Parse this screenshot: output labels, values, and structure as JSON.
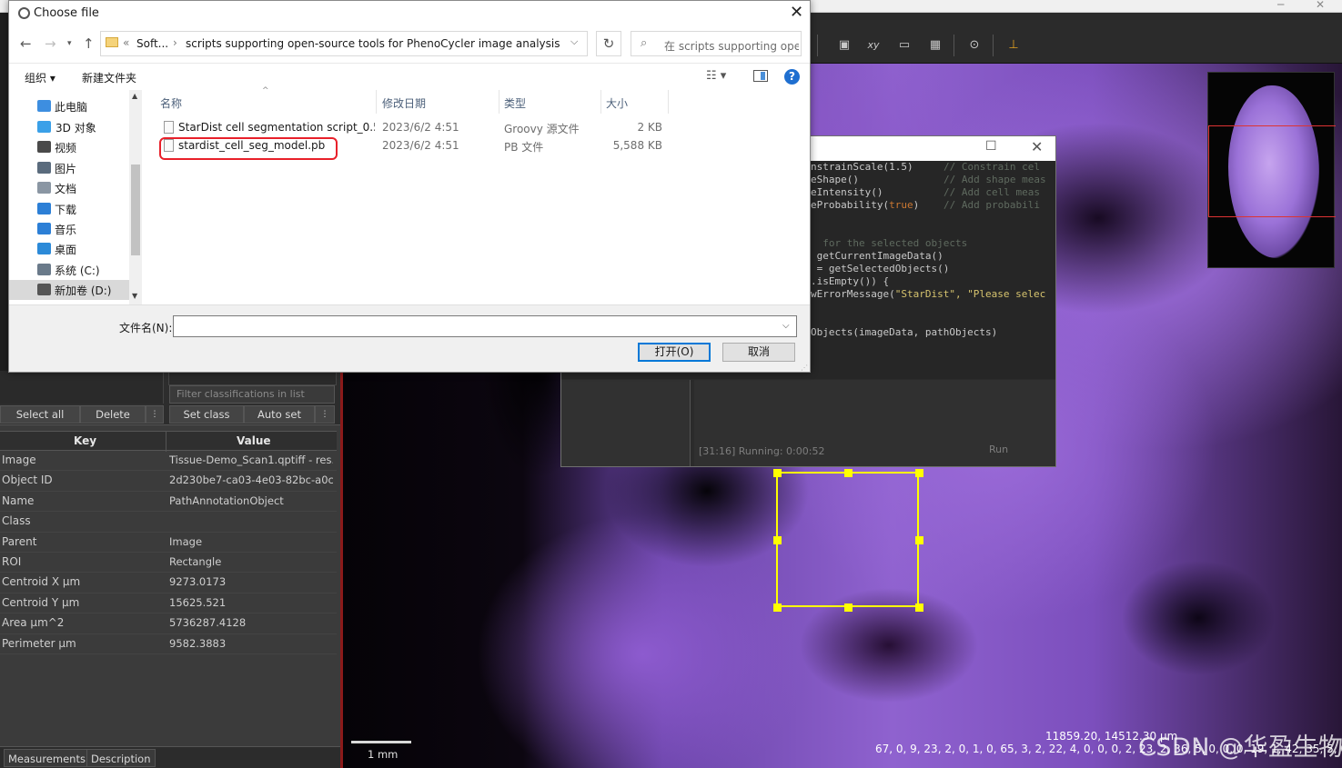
{
  "dialog": {
    "title": "Choose file",
    "address": {
      "overflow": "«",
      "crumbs": [
        "Soft...",
        "scripts supporting open-source tools for PhenoCycler image analysis"
      ]
    },
    "search_placeholder": "在 scripts supporting ope...",
    "commands": {
      "organize": "组织 ▾",
      "new_folder": "新建文件夹"
    },
    "nav_items": [
      {
        "label": "此电脑",
        "icon": "computer-icon",
        "color": "#3d8ee0"
      },
      {
        "label": "3D 对象",
        "icon": "cube-icon",
        "color": "#3aa0e8"
      },
      {
        "label": "视频",
        "icon": "film-icon",
        "color": "#4a4a4a"
      },
      {
        "label": "图片",
        "icon": "picture-icon",
        "color": "#5a6b7d"
      },
      {
        "label": "文档",
        "icon": "document-icon",
        "color": "#8a96a3"
      },
      {
        "label": "下载",
        "icon": "download-arrow-icon",
        "color": "#2c7fd6"
      },
      {
        "label": "音乐",
        "icon": "music-note-icon",
        "color": "#2c7fd6"
      },
      {
        "label": "桌面",
        "icon": "desktop-icon",
        "color": "#2c8ad8"
      },
      {
        "label": "系统 (C:)",
        "icon": "drive-c-icon",
        "color": "#6a7a8a"
      },
      {
        "label": "新加卷 (D:)",
        "icon": "drive-d-icon",
        "color": "#555555"
      }
    ],
    "columns": {
      "name": "名称",
      "modified": "修改日期",
      "type": "类型",
      "size": "大小"
    },
    "files": [
      {
        "name": "StarDist cell segmentation script_0.5_...",
        "modified": "2023/6/2 4:51",
        "type": "Groovy 源文件",
        "size": "2 KB"
      },
      {
        "name": "stardist_cell_seg_model.pb",
        "modified": "2023/6/2 4:51",
        "type": "PB 文件",
        "size": "5,588 KB"
      }
    ],
    "filename_label": "文件名(N):",
    "filename_value": "",
    "open_button": "打开(O)",
    "cancel_button": "取消",
    "highlight_color": "#e8202a"
  },
  "left_panel": {
    "filter_placeholder": "Filter classifications in list",
    "buttons": {
      "select_all": "Select all",
      "delete": "Delete",
      "set_class": "Set class",
      "auto_set": "Auto set"
    },
    "table_headers": {
      "key": "Key",
      "value": "Value"
    },
    "rows": [
      {
        "key": "Image",
        "value": "Tissue-Demo_Scan1.qptiff - res..."
      },
      {
        "key": "Object ID",
        "value": "2d230be7-ca03-4e03-82bc-a0c..."
      },
      {
        "key": "Name",
        "value": "PathAnnotationObject"
      },
      {
        "key": "Class",
        "value": ""
      },
      {
        "key": "Parent",
        "value": "Image"
      },
      {
        "key": "ROI",
        "value": "Rectangle"
      },
      {
        "key": "Centroid X µm",
        "value": "9273.0173"
      },
      {
        "key": "Centroid Y µm",
        "value": "15625.521"
      },
      {
        "key": "Area µm^2",
        "value": "5736287.4128"
      },
      {
        "key": "Perimeter µm",
        "value": "9582.3883"
      }
    ],
    "tabs": {
      "measurements": "Measurements",
      "description": "Description"
    }
  },
  "editor": {
    "code_lines": [
      {
        "code": "nstrainScale(1.5)",
        "comment": "// Constrain cel"
      },
      {
        "code": "eShape()",
        "comment": "// Add shape meas"
      },
      {
        "code": "eIntensity()",
        "comment": "// Add cell meas"
      },
      {
        "code": "eProbability(",
        "code_true": "true",
        "code_end": ")",
        "comment": "// Add probabili"
      },
      {
        "code": "",
        "comment": ""
      },
      {
        "code": "  for the selected objects",
        "comment": ""
      },
      {
        "code": " getCurrentImageData()",
        "comment": ""
      },
      {
        "code": " = getSelectedObjects()",
        "comment": ""
      },
      {
        "code": ".isEmpty()) {",
        "comment": ""
      },
      {
        "code": "wErrorMessage(",
        "code_str": "\"StarDist\", \"Please selec",
        "comment": ""
      },
      {
        "code": "",
        "comment": ""
      },
      {
        "code": "",
        "comment": ""
      },
      {
        "code": "Objects(imageData, pathObjects)",
        "comment": ""
      }
    ],
    "status": "[31:16]  Running: 0:00:52",
    "run_label": "Run"
  },
  "viewer": {
    "scale_label": "1 mm",
    "coords": "11859.20, 14512.30 µm",
    "channels": "67, 0, 9, 23, 2, 0, 1, 0, 65, 3, 2, 22, 4, 0, 0, 0, 2, 23, 2, 36, 5, 0, 0, 0, 19, 1, 42, 35, 5, 0, 3, 1, 20",
    "watermark": "CSDN @华盈生物",
    "selection_color": "#ffff00"
  },
  "toolbar": {
    "icons": [
      "fit-window-icon",
      "xy-icon",
      "ruler-icon",
      "grid-icon",
      "settings-icon",
      "pin-icon"
    ],
    "xy_label": "xy"
  }
}
